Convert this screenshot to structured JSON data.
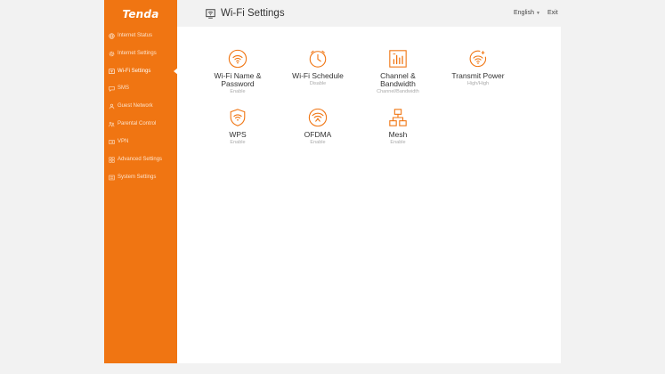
{
  "brand": {
    "logo_text": "Tenda"
  },
  "colors": {
    "accent": "#f07512",
    "content_bg": "#ffffff",
    "page_bg": "#f2f2f2"
  },
  "sidebar": {
    "items": [
      {
        "label": "Internet Status",
        "icon": "globe-icon"
      },
      {
        "label": "Internet Settings",
        "icon": "gear-icon"
      },
      {
        "label": "Wi-Fi Settings",
        "icon": "wifi-screen-icon",
        "active": true
      },
      {
        "label": "SMS",
        "icon": "message-icon"
      },
      {
        "label": "Guest Network",
        "icon": "guest-user-icon"
      },
      {
        "label": "Parental Control",
        "icon": "family-icon"
      },
      {
        "label": "VPN",
        "icon": "vpn-icon"
      },
      {
        "label": "Advanced Settings",
        "icon": "grid-icon"
      },
      {
        "label": "System Settings",
        "icon": "system-icon"
      }
    ]
  },
  "header": {
    "title": "Wi-Fi Settings",
    "title_icon": "wifi-screen-icon",
    "language": "English",
    "exit_label": "Exit"
  },
  "tiles": [
    {
      "label": "Wi-Fi Name & Password",
      "sub": "Enable",
      "icon": "wifi-circle-icon"
    },
    {
      "label": "Wi-Fi Schedule",
      "sub": "Disable",
      "icon": "clock-icon"
    },
    {
      "label": "Channel & Bandwidth",
      "sub": "Channel/Bandwidth",
      "icon": "channel-bars-icon"
    },
    {
      "label": "Transmit Power",
      "sub": "High/High",
      "icon": "transmit-power-icon"
    },
    {
      "label": "WPS",
      "sub": "Enable",
      "icon": "shield-wifi-icon"
    },
    {
      "label": "OFDMA",
      "sub": "Enable",
      "icon": "ofdma-icon"
    },
    {
      "label": "Mesh",
      "sub": "Enable",
      "icon": "mesh-icon"
    }
  ]
}
